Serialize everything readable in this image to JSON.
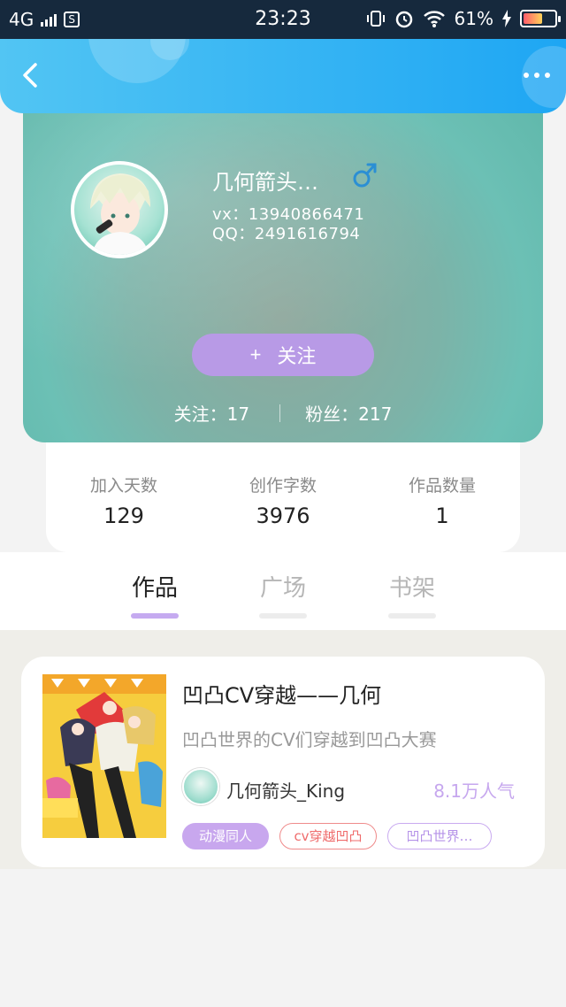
{
  "status_bar": {
    "network": "4G",
    "sim_label": "S",
    "time": "23:23",
    "battery": "61%",
    "battery_level": 0.61
  },
  "nav": {
    "back_icon": "chevron-left-icon",
    "more_icon": "more-dots-icon"
  },
  "profile": {
    "nickname": "几何箭头…",
    "gender_icon": "male-icon",
    "gender_color": "#2b8fd4",
    "vx": "vx：13940866471",
    "qq": "QQ：2491616794",
    "follow_button": {
      "icon": "+",
      "label": "关注"
    },
    "following": "关注：17",
    "fans": "粉丝：217"
  },
  "stats": [
    {
      "label": "加入天数",
      "value": "129"
    },
    {
      "label": "创作字数",
      "value": "3976"
    },
    {
      "label": "作品数量",
      "value": "1"
    }
  ],
  "tabs": [
    {
      "label": "作品",
      "active": true
    },
    {
      "label": "广场",
      "active": false
    },
    {
      "label": "书架",
      "active": false
    }
  ],
  "work": {
    "title": "凹凸CV穿越——几何",
    "description": "凹凸世界的CV们穿越到凹凸大赛",
    "author": "几何箭头_King",
    "popularity": "8.1万人气",
    "tags": [
      "动漫同人",
      "cv穿越凹凸",
      "凹凸世界…"
    ]
  },
  "colors": {
    "accent": "#b89ae6",
    "nav_blue": "#1ea6f3",
    "status_bar": "#16293d"
  }
}
